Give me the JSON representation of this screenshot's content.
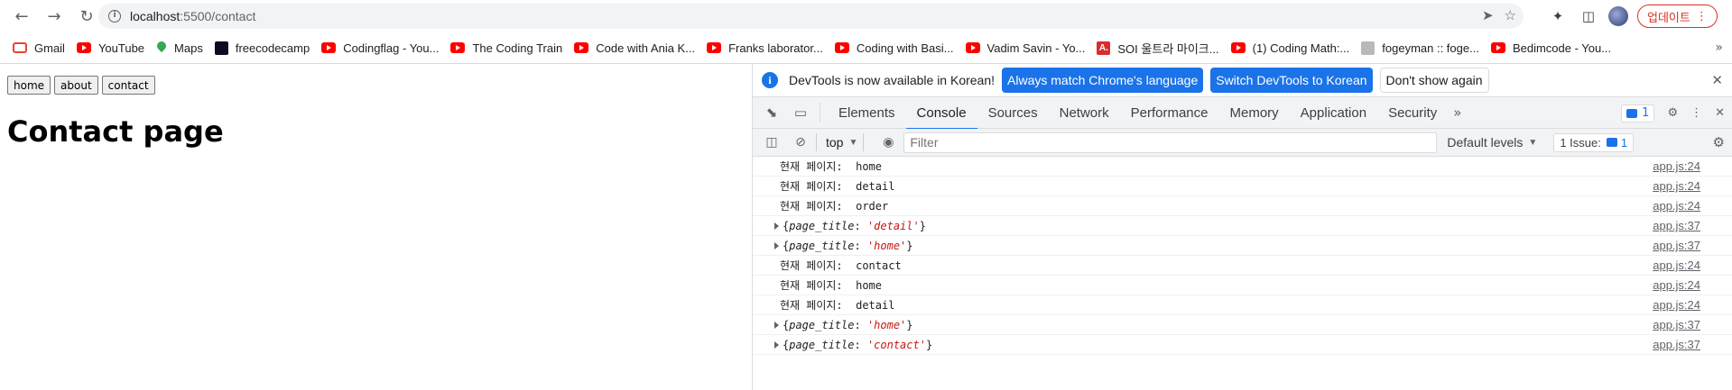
{
  "browser": {
    "url_host": "localhost",
    "url_path": ":5500/contact",
    "update_label": "업데이트"
  },
  "bookmarks": [
    {
      "label": "Gmail",
      "icon": "gmail-icon"
    },
    {
      "label": "YouTube",
      "icon": "youtube-icon"
    },
    {
      "label": "Maps",
      "icon": "maps-icon"
    },
    {
      "label": "freecodecamp",
      "icon": "freecodecamp-icon"
    },
    {
      "label": "Codingflag - You...",
      "icon": "youtube-icon"
    },
    {
      "label": "The Coding Train",
      "icon": "youtube-icon"
    },
    {
      "label": "Code with Ania K...",
      "icon": "youtube-icon"
    },
    {
      "label": "Franks laborator...",
      "icon": "youtube-icon"
    },
    {
      "label": "Coding with Basi...",
      "icon": "youtube-icon"
    },
    {
      "label": "Vadim Savin - Yo...",
      "icon": "youtube-icon"
    },
    {
      "label": "SOI 울트라 마이크...",
      "icon": "a-icon"
    },
    {
      "label": "(1) Coding Math:...",
      "icon": "youtube-icon"
    },
    {
      "label": "fogeyman :: foge...",
      "icon": "fogeyman-icon"
    },
    {
      "label": "Bedimcode - You...",
      "icon": "youtube-icon"
    }
  ],
  "page": {
    "nav": [
      "home",
      "about",
      "contact"
    ],
    "heading": "Contact page"
  },
  "devtools": {
    "infobar": {
      "message": "DevTools is now available in Korean!",
      "btn_match": "Always match Chrome's language",
      "btn_switch": "Switch DevTools to Korean",
      "btn_dismiss": "Don't show again"
    },
    "tabs": [
      "Elements",
      "Console",
      "Sources",
      "Network",
      "Performance",
      "Memory",
      "Application",
      "Security"
    ],
    "active_tab": "Console",
    "message_count": "1",
    "context": "top",
    "filter_placeholder": "Filter",
    "levels": "Default levels",
    "issues_label": "1 Issue:",
    "issues_count": "1",
    "logs": [
      {
        "type": "text",
        "text": "현재 페이지:  home",
        "src": "app.js:24"
      },
      {
        "type": "text",
        "text": "현재 페이지:  detail",
        "src": "app.js:24"
      },
      {
        "type": "text",
        "text": "현재 페이지:  order",
        "src": "app.js:24"
      },
      {
        "type": "obj",
        "key": "page_title",
        "val": "'detail'",
        "src": "app.js:37"
      },
      {
        "type": "obj",
        "key": "page_title",
        "val": "'home'",
        "src": "app.js:37"
      },
      {
        "type": "text",
        "text": "현재 페이지:  contact",
        "src": "app.js:24"
      },
      {
        "type": "text",
        "text": "현재 페이지:  home",
        "src": "app.js:24"
      },
      {
        "type": "text",
        "text": "현재 페이지:  detail",
        "src": "app.js:24"
      },
      {
        "type": "obj",
        "key": "page_title",
        "val": "'home'",
        "src": "app.js:37"
      },
      {
        "type": "obj",
        "key": "page_title",
        "val": "'contact'",
        "src": "app.js:37"
      }
    ]
  }
}
